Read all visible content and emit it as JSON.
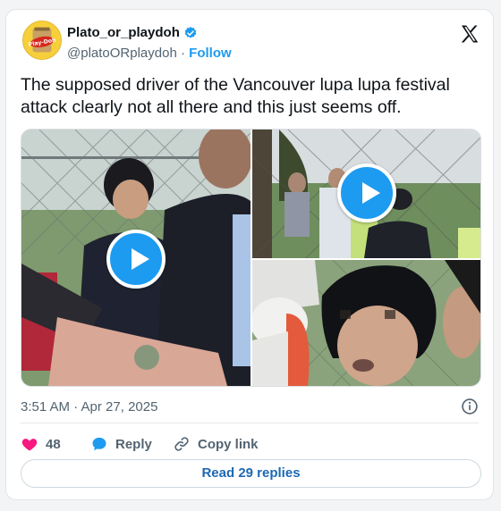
{
  "author": {
    "name": "Plato_or_playdoh",
    "handle": "@platoORplaydoh",
    "separator": "·",
    "follow_label": "Follow",
    "avatar_text": "Play-Doh"
  },
  "tweet": {
    "text": "The supposed driver of the Vancouver lupa lupa festival attack clearly not all there and this just seems off."
  },
  "media": {
    "items": [
      {
        "kind": "video",
        "has_play_button": true
      },
      {
        "kind": "video",
        "has_play_button": true
      },
      {
        "kind": "video",
        "has_play_button": false
      }
    ]
  },
  "meta": {
    "timestamp": "3:51 AM · Apr 27, 2025"
  },
  "actions": {
    "like_count": "48",
    "reply_label": "Reply",
    "copy_label": "Copy link",
    "read_replies_label": "Read 29 replies"
  },
  "colors": {
    "accent": "#1d9bf0",
    "like": "#f91880",
    "muted": "#536471",
    "text": "#0f1419"
  },
  "icons": [
    "verified-badge-icon",
    "x-logo-icon",
    "play-icon",
    "info-icon",
    "heart-icon",
    "reply-bubble-icon",
    "link-icon"
  ]
}
